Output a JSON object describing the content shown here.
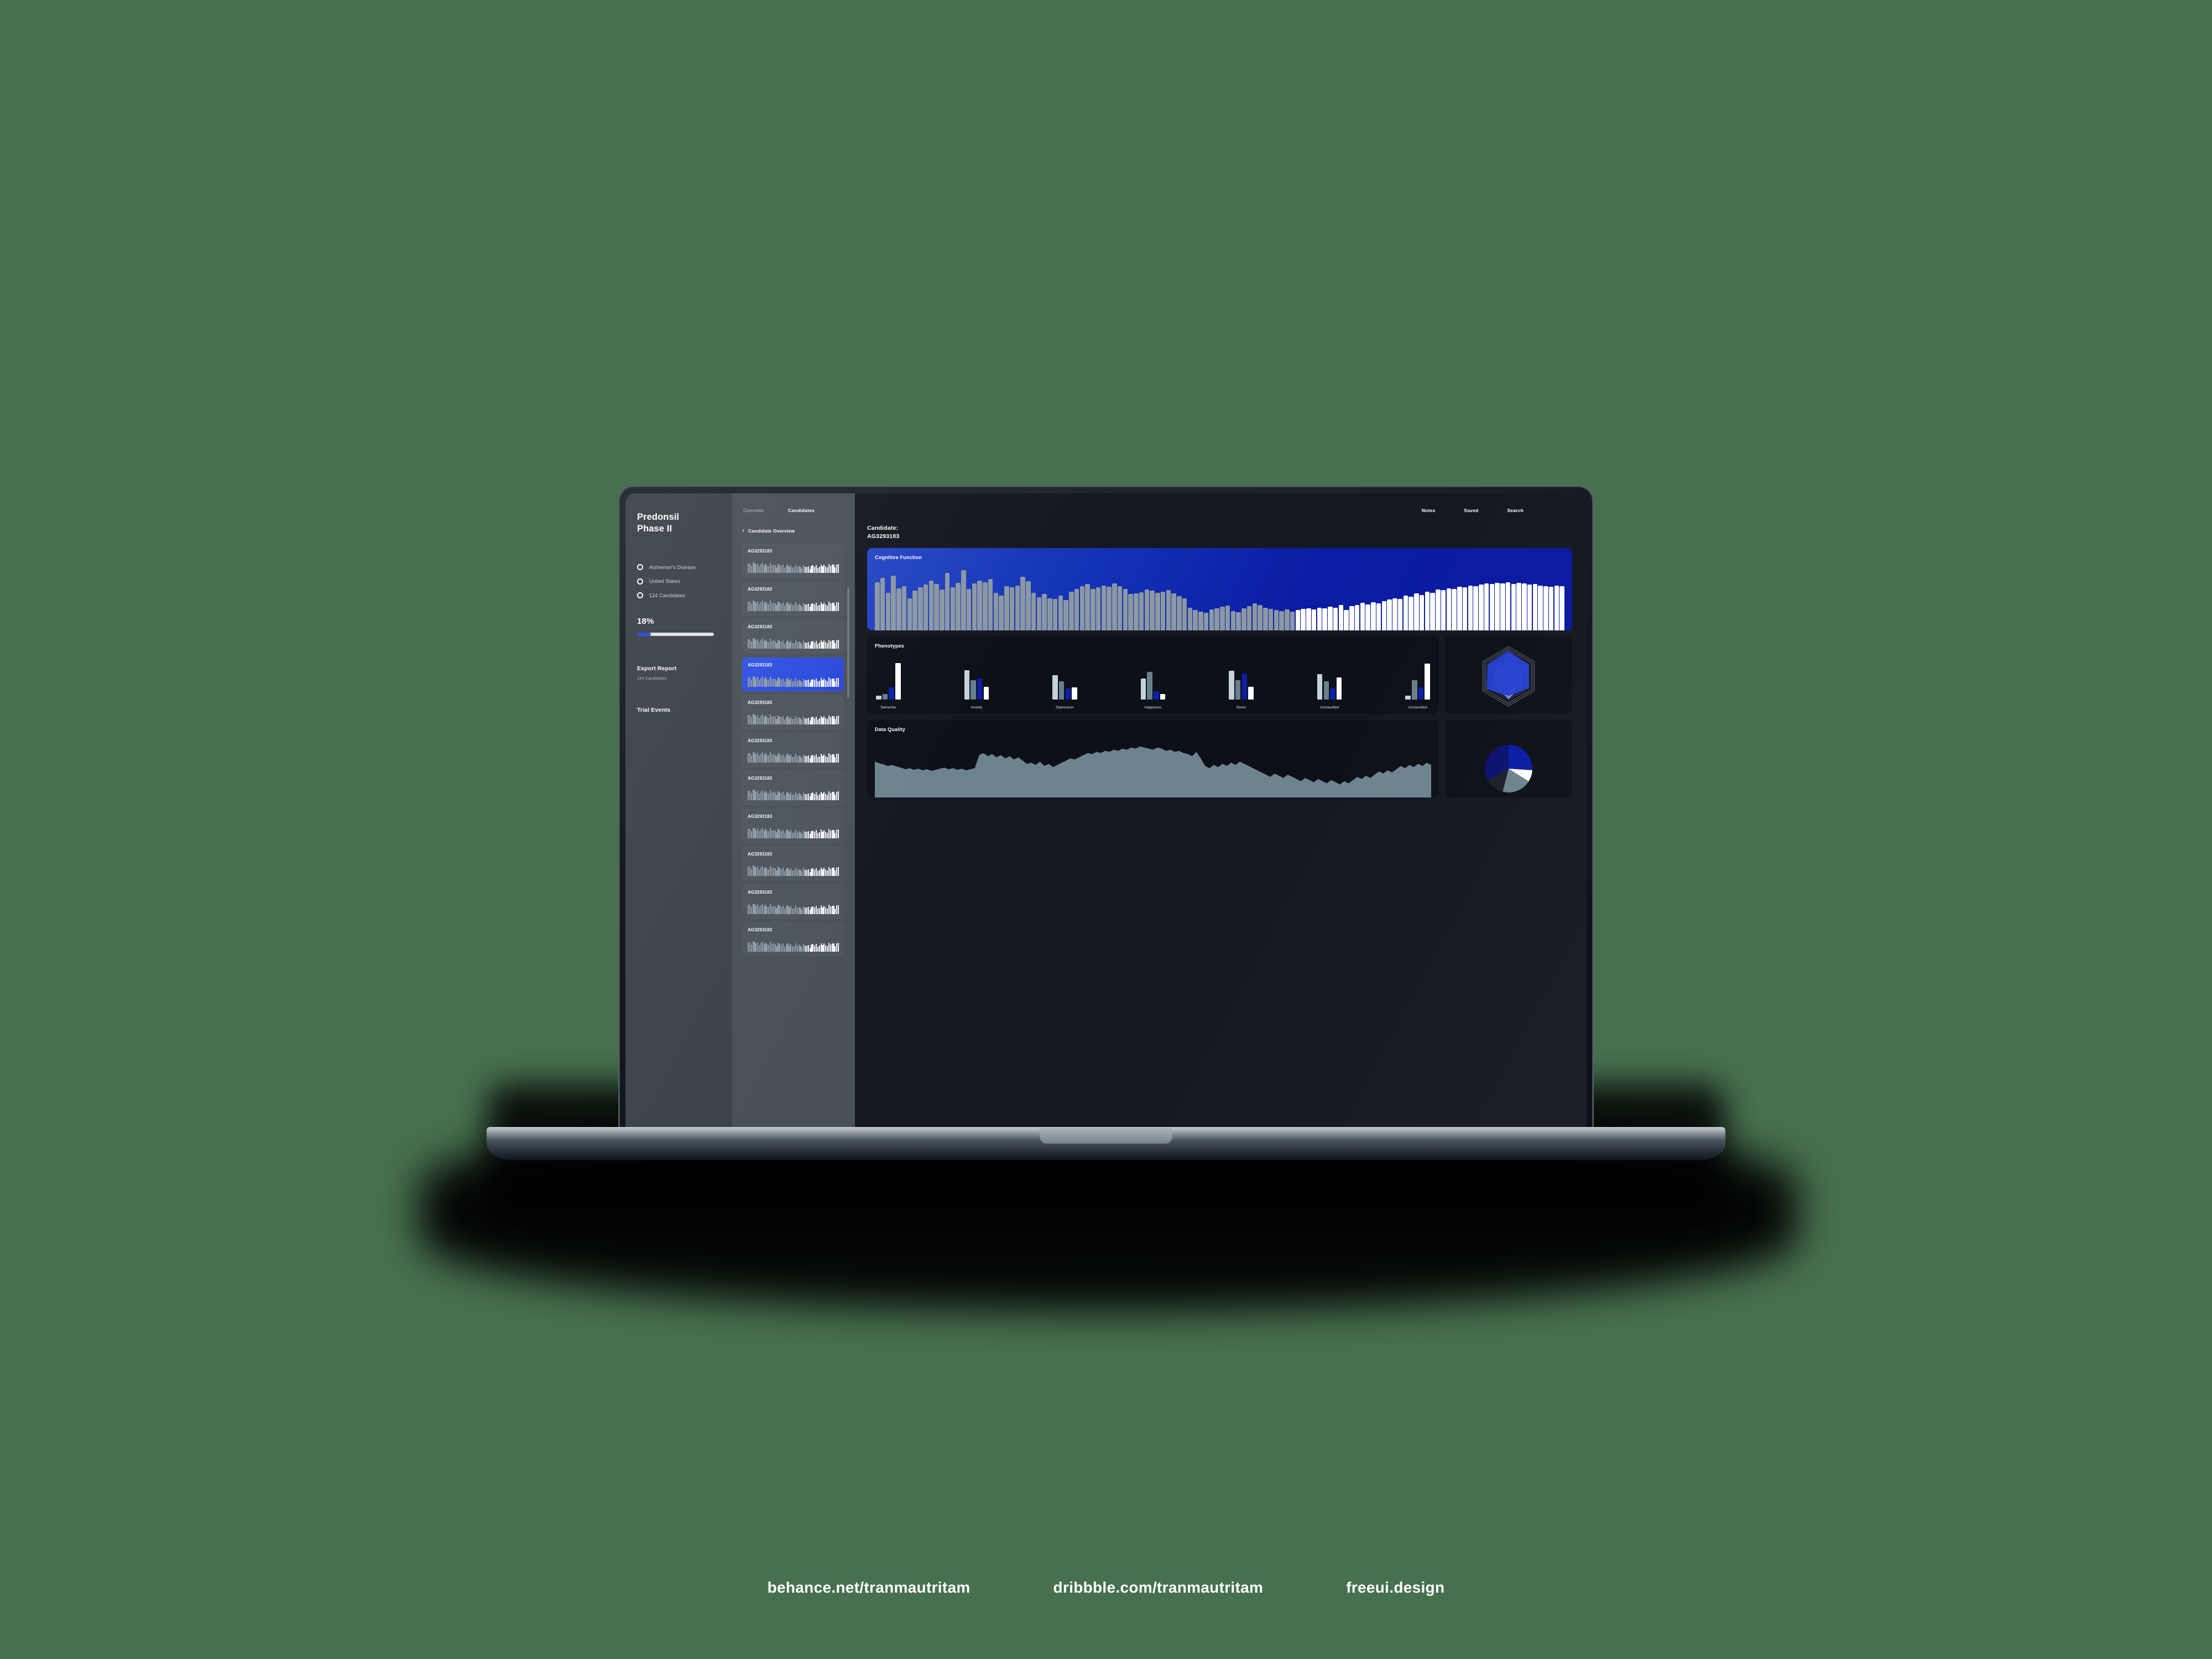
{
  "background_color": "#47704f",
  "accent_blue": "#0a1ca3",
  "sidebar": {
    "brand_line1": "Predonsil",
    "brand_line2": "Phase II",
    "filters": [
      {
        "label": "Alzheimer's Disease"
      },
      {
        "label": "United States"
      },
      {
        "label": "124 Candidates"
      }
    ],
    "progress_label": "18%",
    "progress_value": 18,
    "export": {
      "title": "Export Report",
      "subtitle": "124 Candidates"
    },
    "trial_events": {
      "title": "Trial Events"
    }
  },
  "list_panel": {
    "tabs": [
      {
        "label": "Overview",
        "active": false
      },
      {
        "label": "Candidates",
        "active": true
      }
    ],
    "breadcrumb": {
      "chevron": "chevron-left-icon",
      "label": "Candidate Overview"
    },
    "cards": [
      {
        "id": "AG3293183",
        "selected": false
      },
      {
        "id": "AG3293183",
        "selected": false
      },
      {
        "id": "AG3293183",
        "selected": false
      },
      {
        "id": "AG3293183",
        "selected": true
      },
      {
        "id": "AG3293183",
        "selected": false
      },
      {
        "id": "AG3293183",
        "selected": false
      },
      {
        "id": "AG3293183",
        "selected": false
      },
      {
        "id": "AG3293183",
        "selected": false
      },
      {
        "id": "AG3293183",
        "selected": false
      },
      {
        "id": "AG3293183",
        "selected": false
      },
      {
        "id": "AG3293183",
        "selected": false
      }
    ]
  },
  "main": {
    "top_nav": [
      {
        "label": "Notes"
      },
      {
        "label": "Saved"
      },
      {
        "label": "Search"
      }
    ],
    "candidate_heading": "Candidate:\nAG3293183",
    "cards": {
      "cognitive": "Cognitive Function",
      "phenotypes": "Phenotypes",
      "data_quality": "Data Quality"
    }
  },
  "credits": [
    {
      "label": "behance.net/tranmautritam"
    },
    {
      "label": "dribbble.com/tranmautritam"
    },
    {
      "label": "freeui.design"
    }
  ],
  "chart_data": [
    {
      "type": "bar",
      "title": "Cognitive Function",
      "xlabel": "",
      "ylabel": "",
      "ylim": [
        0,
        100
      ],
      "grid": false,
      "legend": "none",
      "bar_colors": {
        "past": "#8b98a4",
        "recent": "#ffffff"
      },
      "recent_start_index": 78,
      "values": [
        72,
        78,
        56,
        82,
        63,
        66,
        48,
        59,
        64,
        68,
        74,
        69,
        61,
        86,
        64,
        71,
        90,
        62,
        70,
        74,
        72,
        77,
        56,
        52,
        66,
        64,
        67,
        80,
        73,
        56,
        49,
        54,
        48,
        47,
        52,
        45,
        58,
        62,
        66,
        69,
        62,
        64,
        67,
        65,
        70,
        66,
        62,
        54,
        55,
        57,
        61,
        59,
        56,
        58,
        60,
        55,
        51,
        48,
        34,
        30,
        28,
        26,
        31,
        33,
        35,
        37,
        29,
        27,
        33,
        36,
        40,
        38,
        34,
        32,
        30,
        29,
        31,
        28,
        30,
        32,
        33,
        31,
        34,
        33,
        35,
        34,
        38,
        30,
        36,
        38,
        41,
        39,
        42,
        40,
        44,
        46,
        48,
        47,
        52,
        50,
        55,
        53,
        58,
        56,
        61,
        60,
        63,
        62,
        65,
        64,
        67,
        66,
        68,
        70,
        69,
        71,
        70,
        72,
        69,
        71,
        70,
        68,
        69,
        67,
        66,
        65,
        67,
        66
      ]
    },
    {
      "type": "bar",
      "title": "Phenotypes",
      "xlabel": "",
      "ylabel": "",
      "ylim": [
        0,
        100
      ],
      "grid": false,
      "categories": [
        "Dementia",
        "Anxiety",
        "Depression",
        "Happiness",
        "Stress",
        "Unclassified",
        "Unclassified"
      ],
      "series": [
        {
          "name": "series-1",
          "color": "#c5d2da",
          "values": [
            10,
            73,
            61,
            53,
            72,
            64,
            9
          ]
        },
        {
          "name": "series-2",
          "color": "#68808e",
          "values": [
            13,
            48,
            46,
            69,
            48,
            46,
            48
          ]
        },
        {
          "name": "series-3",
          "color": "#0b1fa8",
          "values": [
            30,
            52,
            27,
            21,
            65,
            28,
            31
          ]
        },
        {
          "name": "series-4",
          "color": "#ffffff",
          "values": [
            92,
            32,
            30,
            14,
            32,
            55,
            90
          ]
        }
      ]
    },
    {
      "type": "radar",
      "title": "",
      "axes": [
        "A",
        "B",
        "C",
        "D",
        "E",
        "F"
      ],
      "rings": 4,
      "series": [
        {
          "name": "primary",
          "color": "#1c37cf",
          "values": [
            96,
            88,
            88,
            74,
            96,
            92
          ]
        },
        {
          "name": "secondary",
          "color": "#b9bfc4",
          "values": [
            60,
            60,
            60,
            86,
            62,
            60
          ]
        }
      ]
    },
    {
      "type": "area",
      "title": "Data Quality",
      "xlabel": "",
      "ylabel": "",
      "ylim": [
        0,
        100
      ],
      "grid": false,
      "color": "#6d8490",
      "values": [
        66,
        63,
        61,
        58,
        60,
        57,
        55,
        52,
        54,
        51,
        53,
        50,
        52,
        49,
        51,
        53,
        55,
        52,
        54,
        51,
        53,
        50,
        52,
        54,
        78,
        82,
        76,
        80,
        74,
        78,
        72,
        76,
        70,
        74,
        68,
        62,
        64,
        60,
        66,
        58,
        62,
        56,
        60,
        64,
        68,
        72,
        70,
        74,
        78,
        82,
        80,
        84,
        82,
        86,
        84,
        88,
        86,
        90,
        88,
        92,
        90,
        94,
        92,
        90,
        88,
        92,
        90,
        86,
        88,
        84,
        86,
        82,
        80,
        76,
        84,
        72,
        58,
        54,
        60,
        56,
        62,
        58,
        64,
        60,
        66,
        62,
        58,
        54,
        50,
        46,
        42,
        38,
        44,
        40,
        36,
        42,
        38,
        34,
        30,
        36,
        32,
        28,
        34,
        30,
        26,
        32,
        28,
        24,
        30,
        26,
        32,
        38,
        34,
        40,
        36,
        42,
        48,
        44,
        50,
        46,
        52,
        58,
        54,
        60,
        56,
        62,
        58,
        64,
        60
      ]
    },
    {
      "type": "pie",
      "title": "",
      "labels": [
        "slice-1",
        "slice-2",
        "slice-3",
        "slice-4",
        "slice-5"
      ],
      "values": [
        26,
        8,
        20,
        13,
        33
      ],
      "colors": [
        "#0a1ca3",
        "#ffffff",
        "#6d8490",
        "#1b1f2b",
        "#0a1170"
      ],
      "start_angle": -90
    }
  ]
}
